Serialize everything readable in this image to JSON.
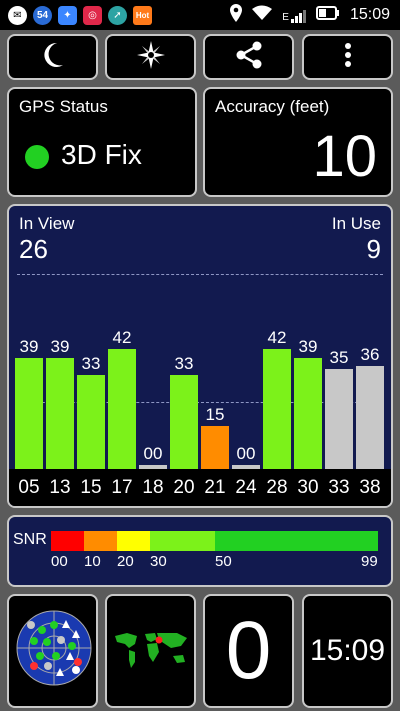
{
  "statusbar": {
    "notif_badge": "54",
    "notif_hot": "Hot",
    "network": "E",
    "time": "15:09"
  },
  "toolbar": {
    "night_mode_icon": "moon-icon",
    "compass_icon": "compass-icon",
    "share_icon": "share-icon",
    "menu_icon": "more-vert-icon"
  },
  "gps_status": {
    "title": "GPS Status",
    "value": "3D Fix",
    "indicator_color": "#22d022"
  },
  "accuracy": {
    "title": "Accuracy (feet)",
    "value": "10"
  },
  "satellites": {
    "in_view_label": "In View",
    "in_view_value": "26",
    "in_use_label": "In Use",
    "in_use_value": "9"
  },
  "chart_data": {
    "type": "bar",
    "categories": [
      "05",
      "13",
      "15",
      "17",
      "18",
      "20",
      "21",
      "24",
      "28",
      "30",
      "33",
      "38"
    ],
    "values": [
      39,
      39,
      33,
      42,
      0,
      33,
      15,
      0,
      42,
      39,
      35,
      36
    ],
    "value_labels": [
      "39",
      "39",
      "33",
      "42",
      "00",
      "33",
      "15",
      "00",
      "42",
      "39",
      "35",
      "36"
    ],
    "status": [
      "used",
      "used",
      "used",
      "used",
      "none",
      "used",
      "weak",
      "none",
      "used",
      "used",
      "unused",
      "unused"
    ],
    "ylim": [
      0,
      58
    ]
  },
  "colors": {
    "used": "#7cf21a",
    "weak": "#ff8c00",
    "unused": "#c8c8c8",
    "none": "#c8c8c8"
  },
  "snr": {
    "label": "SNR",
    "ticks": [
      "00",
      "10",
      "20",
      "30",
      "50",
      "99"
    ],
    "segments": [
      {
        "from": 0,
        "to": 10,
        "color": "#ff0000"
      },
      {
        "from": 10,
        "to": 20,
        "color": "#ff8c00"
      },
      {
        "from": 20,
        "to": 30,
        "color": "#ffff00"
      },
      {
        "from": 30,
        "to": 50,
        "color": "#7cf21a"
      },
      {
        "from": 50,
        "to": 99,
        "color": "#22d022"
      }
    ]
  },
  "bottom": {
    "radar_icon": "sky-radar-icon",
    "map_icon": "world-map-icon",
    "speed": "0",
    "clock": "15:09"
  }
}
